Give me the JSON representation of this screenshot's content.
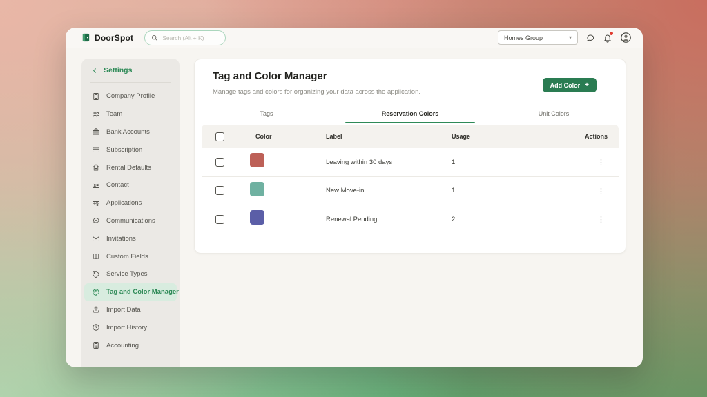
{
  "topbar": {
    "brand": "DoorSpot",
    "search_placeholder": "Search (Alt + K)",
    "group_selector": "Homes Group",
    "icons": [
      "doorspot-logo-icon",
      "search-icon",
      "chevron-down-icon",
      "messages-icon",
      "notifications-icon",
      "avatar-icon"
    ]
  },
  "sidebar": {
    "back_label": "Settings",
    "items": [
      {
        "label": "Company Profile",
        "icon": "building-icon",
        "active": false
      },
      {
        "label": "Team",
        "icon": "team-icon",
        "active": false
      },
      {
        "label": "Bank Accounts",
        "icon": "bank-icon",
        "active": false
      },
      {
        "label": "Subscription",
        "icon": "credit-card-icon",
        "active": false
      },
      {
        "label": "Rental Defaults",
        "icon": "house-icon",
        "active": false
      },
      {
        "label": "Contact",
        "icon": "contact-card-icon",
        "active": false
      },
      {
        "label": "Applications",
        "icon": "sliders-icon",
        "active": false
      },
      {
        "label": "Communications",
        "icon": "chat-icon",
        "active": false
      },
      {
        "label": "Invitations",
        "icon": "mail-icon",
        "active": false
      },
      {
        "label": "Custom Fields",
        "icon": "book-icon",
        "active": false
      },
      {
        "label": "Service Types",
        "icon": "tag-icon",
        "active": false
      },
      {
        "label": "Tag and Color Manager",
        "icon": "palette-icon",
        "active": true
      },
      {
        "label": "Import Data",
        "icon": "upload-icon",
        "active": false
      },
      {
        "label": "Import History",
        "icon": "clock-icon",
        "active": false
      },
      {
        "label": "Accounting",
        "icon": "calculator-icon",
        "active": false
      }
    ]
  },
  "main": {
    "title": "Tag and Color Manager",
    "subtitle": "Manage tags and colors for organizing your data across the application.",
    "add_button_label": "Add Color",
    "add_button_plus": "+",
    "tabs": [
      {
        "label": "Tags",
        "active": false
      },
      {
        "label": "Reservation Colors",
        "active": true
      },
      {
        "label": "Unit Colors",
        "active": false
      }
    ],
    "table": {
      "columns": [
        "Color",
        "Label",
        "Usage",
        "Actions"
      ],
      "rows": [
        {
          "color": "#bd6057",
          "label": "Leaving within 30 days",
          "usage": "1"
        },
        {
          "color": "#6fb1a1",
          "label": "New Move-in",
          "usage": "1"
        },
        {
          "color": "#5b5ea7",
          "label": "Renewal Pending",
          "usage": "2"
        }
      ]
    }
  },
  "colors": {
    "brand_green": "#2a7c52",
    "active_green": "#2e8a57",
    "active_pill_green": "#d8ecdf",
    "notification_dot": "#e03a2f",
    "swatch_red": "#bd6057",
    "swatch_teal": "#6fb1a1",
    "swatch_indigo": "#5b5ea7"
  }
}
